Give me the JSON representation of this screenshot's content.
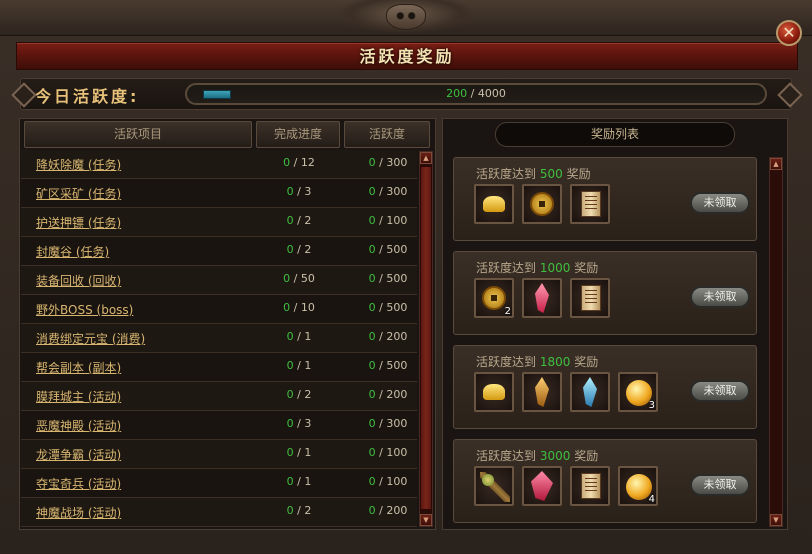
{
  "window": {
    "title": "活跃度奖励",
    "close_label": "✕"
  },
  "activity": {
    "label": "今日活跃度:",
    "current": "200",
    "separator": "/",
    "max": "4000",
    "progress_fraction": 0.05
  },
  "task_table": {
    "headers": {
      "item": "活跃项目",
      "progress": "完成进度",
      "activity": "活跃度"
    },
    "rows": [
      {
        "name": "降妖除魔 (任务)",
        "done": "0",
        "total": "12",
        "act": "0",
        "act_max": "300"
      },
      {
        "name": "矿区采矿 (任务)",
        "done": "0",
        "total": "3",
        "act": "0",
        "act_max": "300"
      },
      {
        "name": "护送押镖 (任务)",
        "done": "0",
        "total": "2",
        "act": "0",
        "act_max": "100"
      },
      {
        "name": "封魔谷 (任务)",
        "done": "0",
        "total": "2",
        "act": "0",
        "act_max": "500"
      },
      {
        "name": "装备回收 (回收)",
        "done": "0",
        "total": "50",
        "act": "0",
        "act_max": "500"
      },
      {
        "name": "野外BOSS (boss)",
        "done": "0",
        "total": "10",
        "act": "0",
        "act_max": "500"
      },
      {
        "name": "消费绑定元宝 (消费)",
        "done": "0",
        "total": "1",
        "act": "0",
        "act_max": "200"
      },
      {
        "name": "帮会副本 (副本)",
        "done": "0",
        "total": "1",
        "act": "0",
        "act_max": "500"
      },
      {
        "name": "膜拜城主 (活动)",
        "done": "0",
        "total": "2",
        "act": "0",
        "act_max": "200"
      },
      {
        "name": "恶魔神殿 (活动)",
        "done": "0",
        "total": "3",
        "act": "0",
        "act_max": "300"
      },
      {
        "name": "龙潭争霸 (活动)",
        "done": "0",
        "total": "1",
        "act": "0",
        "act_max": "100"
      },
      {
        "name": "夺宝奇兵 (活动)",
        "done": "0",
        "total": "1",
        "act": "0",
        "act_max": "100"
      },
      {
        "name": "神魔战场 (活动)",
        "done": "0",
        "total": "2",
        "act": "0",
        "act_max": "200"
      }
    ],
    "separator": "/"
  },
  "rewards": {
    "header": "奖励列表",
    "title_prefix": "活跃度达到",
    "title_suffix": "奖励",
    "claim_label": "未领取",
    "cards": [
      {
        "threshold": "500",
        "items": [
          {
            "icon": "gold-ingot-icon",
            "qty": ""
          },
          {
            "icon": "copper-coin-icon",
            "qty": ""
          },
          {
            "icon": "scroll-icon",
            "qty": ""
          }
        ]
      },
      {
        "threshold": "1000",
        "items": [
          {
            "icon": "copper-coin-icon",
            "qty": "2"
          },
          {
            "icon": "red-crystal-icon",
            "qty": ""
          },
          {
            "icon": "scroll-icon",
            "qty": ""
          }
        ]
      },
      {
        "threshold": "1800",
        "items": [
          {
            "icon": "gold-ingot-icon",
            "qty": ""
          },
          {
            "icon": "amber-crystal-icon",
            "qty": ""
          },
          {
            "icon": "blue-crystal-icon",
            "qty": ""
          },
          {
            "icon": "gold-orb-icon",
            "qty": "3"
          }
        ]
      },
      {
        "threshold": "3000",
        "items": [
          {
            "icon": "staff-icon",
            "qty": ""
          },
          {
            "icon": "red-crystal-cluster-icon",
            "qty": ""
          },
          {
            "icon": "scroll-icon",
            "qty": ""
          },
          {
            "icon": "gold-orb-icon",
            "qty": "4"
          }
        ]
      }
    ]
  },
  "colors": {
    "progress_value": "#3fbf3f",
    "title_bar": "#6a1a10",
    "task_link": "#d8b670"
  }
}
